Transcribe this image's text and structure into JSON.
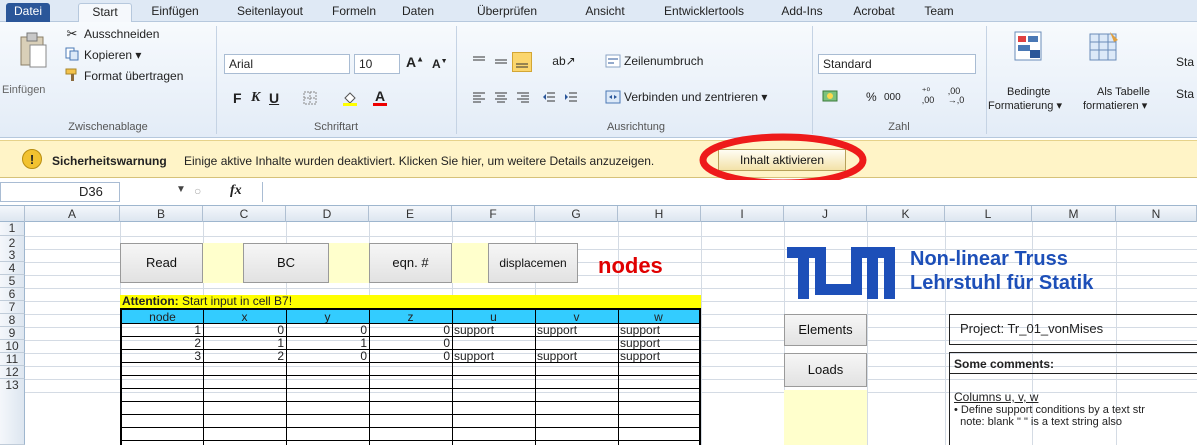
{
  "tabs": [
    "Datei",
    "Start",
    "Einfügen",
    "Seitenlayout",
    "Formeln",
    "Daten",
    "Überprüfen",
    "Ansicht",
    "Entwicklertools",
    "Add-Ins",
    "Acrobat",
    "Team"
  ],
  "clipboard": {
    "cut": "Ausschneiden",
    "copy": "Kopieren ▾",
    "paste": "Einfügen",
    "format_painter": "Format übertragen",
    "group": "Zwischenablage"
  },
  "font": {
    "name": "Arial",
    "size": "10",
    "group": "Schriftart",
    "bold": "F",
    "italic": "K",
    "underline": "U"
  },
  "alignment": {
    "wrap": "Zeilenumbruch",
    "merge": "Verbinden und zentrieren ▾",
    "group": "Ausrichtung"
  },
  "number": {
    "format": "Standard",
    "percent": "%",
    "thousands": "000",
    "group": "Zahl"
  },
  "styles": {
    "conditional": "Bedingte",
    "conditional2": "Formatierung ▾",
    "as_table": "Als Tabelle",
    "as_table2": "formatieren ▾",
    "cut1": "Sta",
    "cut2": "Sta"
  },
  "security": {
    "title": "Sicherheitswarnung",
    "message": "Einige aktive Inhalte wurden deaktiviert. Klicken Sie hier, um weitere Details anzuzeigen.",
    "button": "Inhalt aktivieren"
  },
  "formula_bar": {
    "name_box": "D36",
    "fx": "fx",
    "value": ""
  },
  "columns": [
    "A",
    "B",
    "C",
    "D",
    "E",
    "F",
    "G",
    "H",
    "I",
    "J",
    "K",
    "L",
    "M",
    "N"
  ],
  "rows": [
    "1",
    "2",
    "3",
    "4",
    "5",
    "6",
    "7",
    "8",
    "9",
    "10",
    "11",
    "12",
    "13"
  ],
  "sheet": {
    "buttons": {
      "read": "Read",
      "bc": "BC",
      "eqn": "eqn. #",
      "disp": "displacemen",
      "elements": "Elements",
      "loads": "Loads"
    },
    "nodes_title": "nodes",
    "attention_bold": "Attention:",
    "attention_text": " Start input in cell B7!",
    "headers": [
      "node",
      "x",
      "y",
      "z",
      "u",
      "v",
      "w"
    ],
    "data": [
      [
        "1",
        "0",
        "0",
        "0",
        "support",
        "support",
        "support"
      ],
      [
        "2",
        "1",
        "1",
        "0",
        "",
        "",
        "support"
      ],
      [
        "3",
        "2",
        "0",
        "0",
        "support",
        "support",
        "support"
      ]
    ],
    "logo_line1": "Non-linear Truss",
    "logo_line2": "Lehrstuhl für Statik",
    "project": "Project: Tr_01_vonMises",
    "comments_title": "Some comments:",
    "columns_note": "Columns u, v, w",
    "bullet1": "• Define support conditions by a text str",
    "bullet2": "  note: blank \" \" is a text string also",
    "colors": {
      "accent": "#2a5699",
      "tum_blue": "#1d4fb8",
      "red": "#e00000",
      "yellow": "#ffff00",
      "cyan": "#33ccff",
      "cream": "#ffffcc"
    }
  }
}
